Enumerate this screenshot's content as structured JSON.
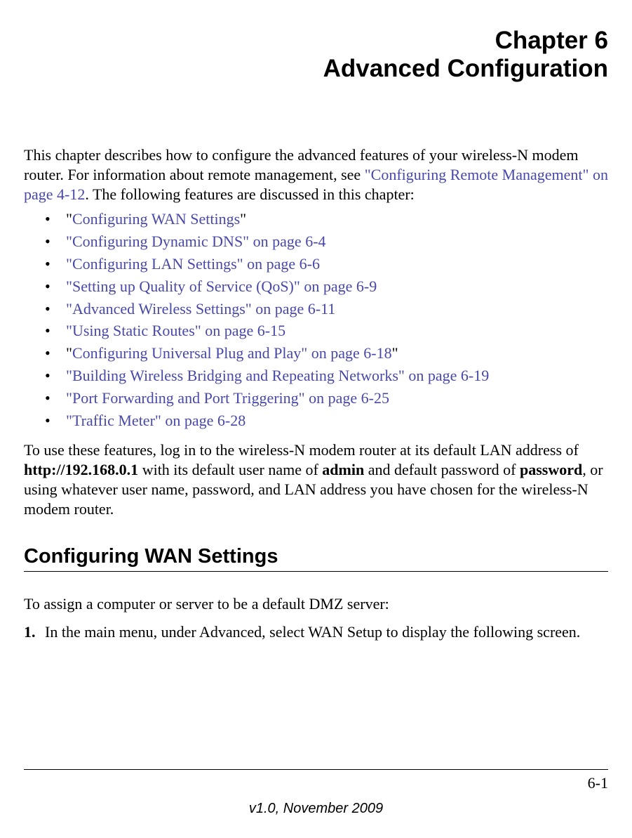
{
  "chapter": {
    "number": "Chapter 6",
    "title": "Advanced Configuration"
  },
  "intro": {
    "part1": "This chapter describes how to configure the advanced features of your wireless-N modem router. For information about remote management, see ",
    "link1": "\"Configuring Remote Management\" on page 4-12",
    "part2": ". The following features are discussed in this chapter:"
  },
  "bullets": [
    {
      "prefix": "\"",
      "link": "Configuring WAN Settings",
      "suffix": "\""
    },
    {
      "prefix": "",
      "link": "\"Configuring Dynamic DNS\" on page 6-4",
      "suffix": ""
    },
    {
      "prefix": "",
      "link": "\"Configuring LAN Settings\" on page 6-6",
      "suffix": ""
    },
    {
      "prefix": "",
      "link": "\"Setting up Quality of Service (QoS)\" on page 6-9",
      "suffix": ""
    },
    {
      "prefix": "",
      "link": "\"Advanced Wireless Settings\" on page 6-11",
      "suffix": ""
    },
    {
      "prefix": "",
      "link": "\"Using Static Routes\" on page 6-15",
      "suffix": ""
    },
    {
      "prefix": "\"",
      "link": "Configuring Universal Plug and Play\" on page 6-18",
      "suffix": "\""
    },
    {
      "prefix": "",
      "link": "\"Building Wireless Bridging and Repeating Networks\" on page 6-19",
      "suffix": ""
    },
    {
      "prefix": "",
      "link": "\"Port Forwarding and Port Triggering\" on page 6-25",
      "suffix": ""
    },
    {
      "prefix": "",
      "link": "\"Traffic Meter\" on page 6-28",
      "suffix": ""
    }
  ],
  "login_para": {
    "p1": "To use these features, log in to the wireless-N modem router at its default LAN address of ",
    "b1": "http://192.168.0.1",
    "p2": " with its default user name of ",
    "b2": "admin",
    "p3": " and default password of ",
    "b3": "password",
    "p4": ", or using whatever user name, password, and LAN address you have chosen for the wireless-N modem router."
  },
  "section": {
    "heading": "Configuring WAN Settings",
    "intro": "To assign a computer or server to be a default DMZ server:",
    "step1_num": "1.",
    "step1_text": "In the main menu, under Advanced, select WAN Setup to display the following screen."
  },
  "footer": {
    "page_number": "6-1",
    "version": "v1.0, November 2009"
  }
}
